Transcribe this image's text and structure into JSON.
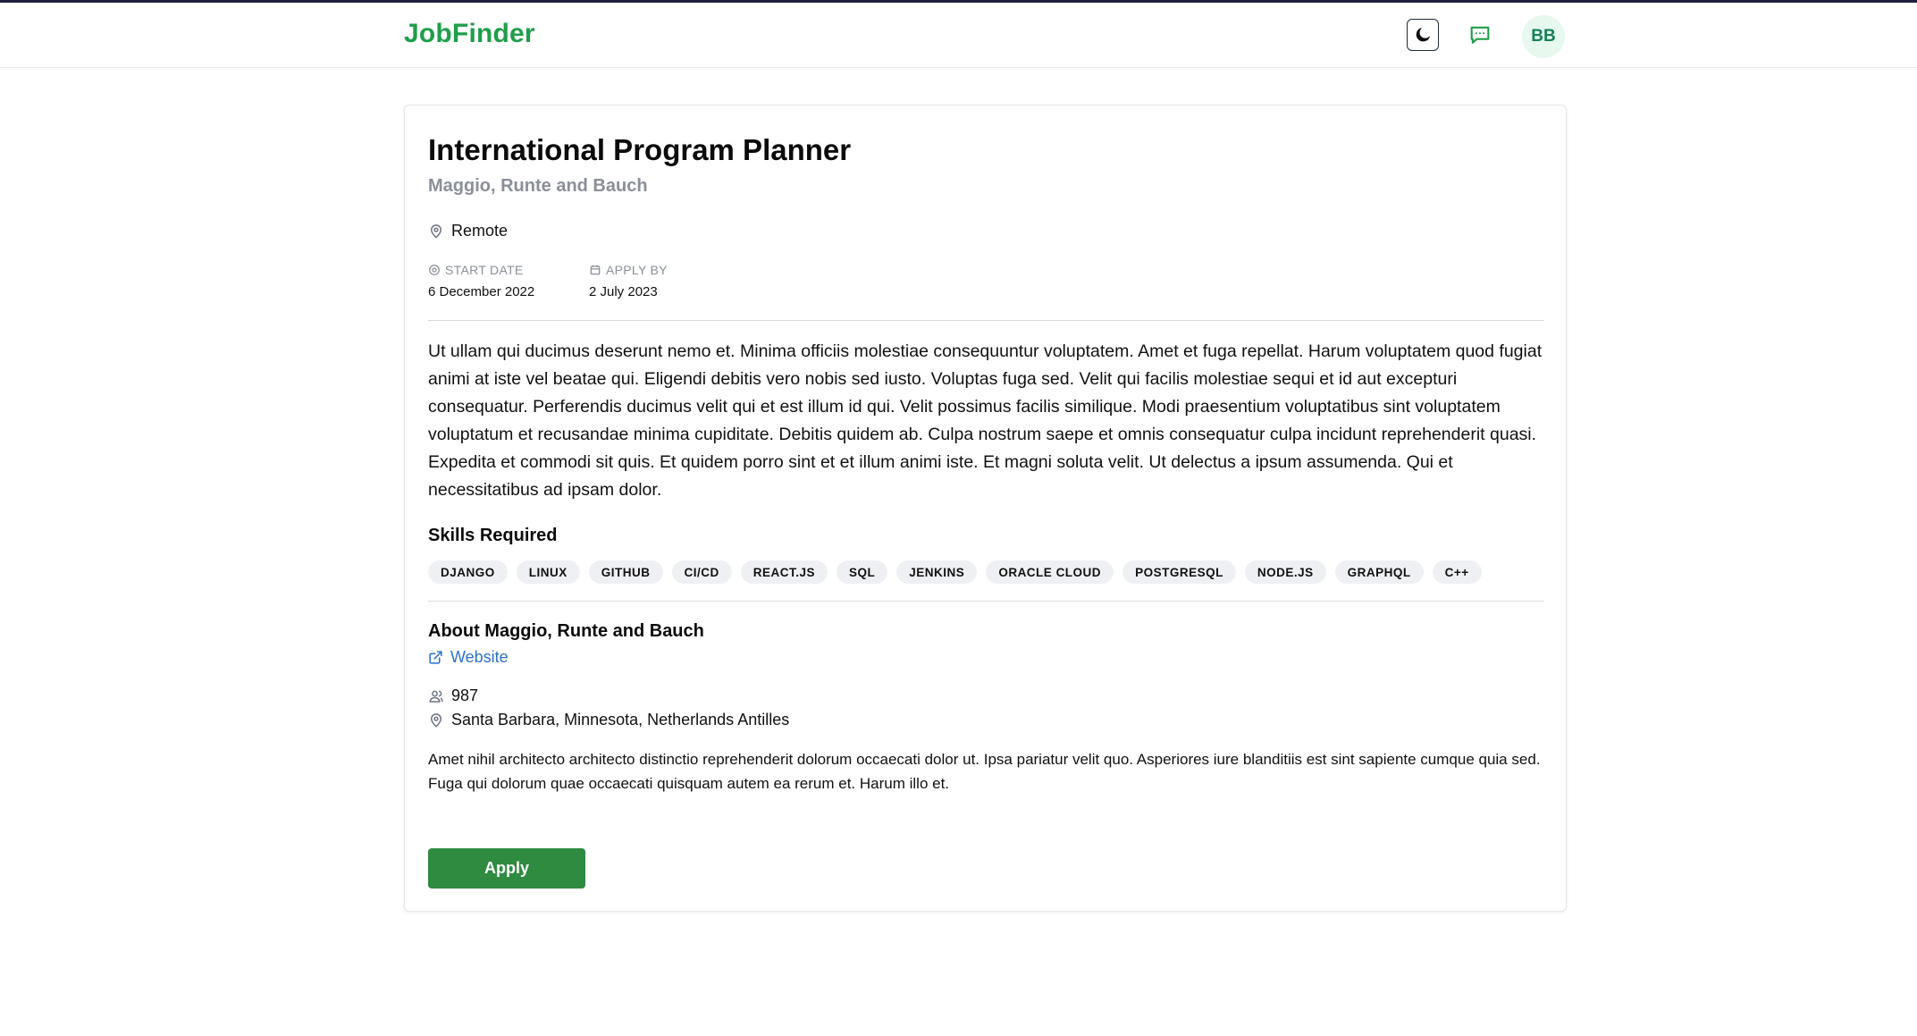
{
  "header": {
    "brand": "JobFinder",
    "avatar_initials": "BB",
    "icons": {
      "theme": "moon-icon",
      "messages": "chat-icon"
    },
    "accent_color": "#1e9e4a"
  },
  "job": {
    "title": "International Program Planner",
    "company": "Maggio, Runte and Bauch",
    "location": "Remote",
    "start_date_label": "START DATE",
    "start_date": "6 December 2022",
    "apply_by_label": "APPLY BY",
    "apply_by": "2 July 2023",
    "description": "Ut ullam qui ducimus deserunt nemo et. Minima officiis molestiae consequuntur voluptatem. Amet et fuga repellat. Harum voluptatem quod fugiat animi at iste vel beatae qui. Eligendi debitis vero nobis sed iusto. Voluptas fuga sed. Velit qui facilis molestiae sequi et id aut excepturi consequatur. Perferendis ducimus velit qui et est illum id qui. Velit possimus facilis similique. Modi praesentium voluptatibus sint voluptatem voluptatum et recusandae minima cupiditate. Debitis quidem ab. Culpa nostrum saepe et omnis consequatur culpa incidunt reprehenderit quasi. Expedita et commodi sit quis. Et quidem porro sint et et illum animi iste. Et magni soluta velit. Ut delectus a ipsum assumenda. Qui et necessitatibus ad ipsam dolor.",
    "skills_title": "Skills Required",
    "skills": [
      "DJANGO",
      "LINUX",
      "GITHUB",
      "CI/CD",
      "REACT.JS",
      "SQL",
      "JENKINS",
      "ORACLE CLOUD",
      "POSTGRESQL",
      "NODE.JS",
      "GRAPHQL",
      "C++"
    ]
  },
  "about": {
    "title": "About Maggio, Runte and Bauch",
    "website_label": "Website",
    "employees": "987",
    "address": "Santa Barbara, Minnesota, Netherlands Antilles",
    "description": "Amet nihil architecto architecto distinctio reprehenderit dolorum occaecati dolor ut. Ipsa pariatur velit quo. Asperiores iure blanditiis est sint sapiente cumque quia sed. Fuga qui dolorum quae occaecati quisquam autem ea rerum et. Harum illo et."
  },
  "actions": {
    "apply_label": "Apply",
    "apply_color": "#2e8b40"
  }
}
